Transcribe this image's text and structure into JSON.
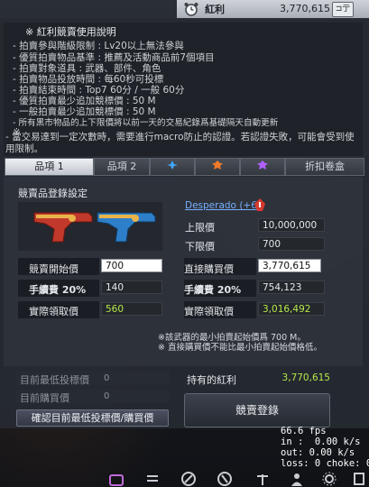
{
  "currency_bar": {
    "label": "紅利",
    "value": "3,770,615",
    "button_label": "⊐亍"
  },
  "info": {
    "title": "※ 紅利競賣使用說明",
    "lines": [
      "- 拍賣參與階級限制 : Lv20以上無法參與",
      "- 優質拍賣物品基準 : 推薦及活動商品前7個項目",
      "- 拍賣對象道具 : 武器、部件、角色",
      "- 拍賣物品投放時間 : 每60秒可投標",
      "- 拍賣結束時間 : Top7 60分 / 一般 60分",
      "- 優質拍賣最少追加競標價 : 50 M",
      "- 一般拍賣最少追加競標價 : 50 M",
      "- 所有黑市物品的上下限價將以前一天的交易紀錄爲基礎隔天自動更新",
      "※",
      "- 當交易達到一定次數時，需要進行macro防止的認證。若認證失敗，可能會受到使用限制。"
    ]
  },
  "tabs": {
    "tab1": "品項 1",
    "tab2": "品項 2",
    "tab6": "折扣卷盒"
  },
  "registration": {
    "title": "競賣品登錄設定",
    "item_name": "Desperado (+6)",
    "upper_label": "上限價",
    "upper_value": "10,000,000",
    "lower_label": "下限價",
    "lower_value": "700",
    "start_label": "競賣開始價",
    "start_value": "700",
    "buy_label": "直接購買價",
    "buy_value": "3,770,615",
    "fee_label": "手續費 20%",
    "fee_value_left": "140",
    "fee_value_right": "754,123",
    "actual_label": "實際領取價",
    "actual_value_left": "560",
    "actual_value_right": "3,016,492",
    "note1": "※該武器的最小拍賣起始價爲 700 M。",
    "note2": "※ 直接購買價不能比最小拍賣起始價格低。"
  },
  "bottom": {
    "current_min_bid_label": "目前最低投標價",
    "current_min_bid_value": "0",
    "current_buy_label": "目前購買價",
    "current_buy_value": "0",
    "confirm_button": "確認目前最低投標價/購買價",
    "owned_label": "持有的紅利",
    "owned_value": "3,770,615",
    "register_button": "競賣登錄"
  },
  "netgraph": {
    "fps": "66.6 fps",
    "in": "in :  0.00 k/s",
    "out": "out: 0.00 k/s",
    "loss": "loss: 0 choke: 0"
  },
  "colors": {
    "accent_green": "#b6e84a",
    "link_blue": "#76b0ff",
    "danger_red": "#d63a2f"
  }
}
